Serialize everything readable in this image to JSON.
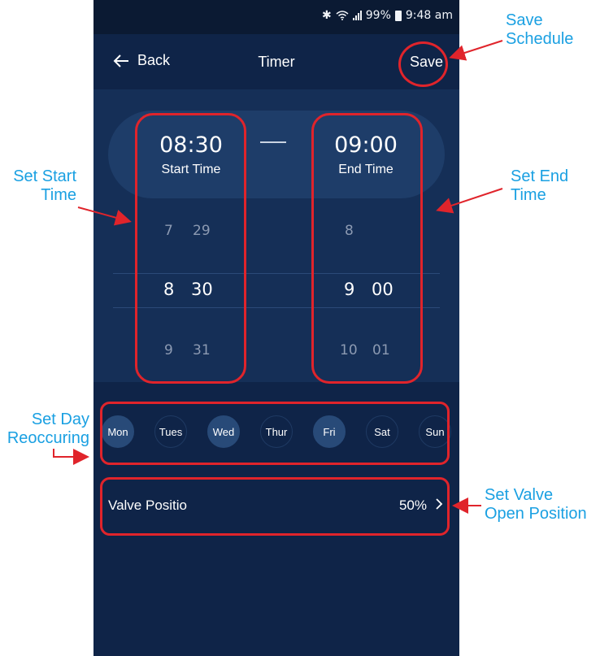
{
  "status": {
    "battery": "99%",
    "time": "9:48 am"
  },
  "appbar": {
    "back_label": "Back",
    "title": "Timer",
    "save_label": "Save"
  },
  "start": {
    "time": "08:30",
    "label": "Start Time",
    "wheel": [
      {
        "h": "7",
        "m": "29"
      },
      {
        "h": "8",
        "m": "30"
      },
      {
        "h": "9",
        "m": "31"
      }
    ]
  },
  "end": {
    "time": "09:00",
    "label": "End Time",
    "wheel": [
      {
        "h": "8",
        "m": ""
      },
      {
        "h": "9",
        "m": "00"
      },
      {
        "h": "10",
        "m": "01"
      }
    ]
  },
  "days": [
    {
      "label": "Mon",
      "selected": true
    },
    {
      "label": "Tues",
      "selected": false
    },
    {
      "label": "Wed",
      "selected": true
    },
    {
      "label": "Thur",
      "selected": false
    },
    {
      "label": "Fri",
      "selected": true
    },
    {
      "label": "Sat",
      "selected": false
    },
    {
      "label": "Sun",
      "selected": false
    }
  ],
  "valve": {
    "label": "Valve Positio",
    "value": "50%"
  },
  "annotations": {
    "save_schedule": [
      "Save",
      "Schedule"
    ],
    "set_start_time": [
      "Set Start",
      "Time"
    ],
    "set_end_time": [
      "Set End",
      "Time"
    ],
    "set_day": [
      "Set Day",
      "Reoccuring"
    ],
    "set_valve": [
      "Set Valve",
      "Open Position"
    ]
  },
  "colors": {
    "background": "#0f2448",
    "panel": "#152f57",
    "annotation_frame": "#e0242b",
    "annotation_text": "#1aa0e2",
    "day_selected": "#284a78"
  }
}
